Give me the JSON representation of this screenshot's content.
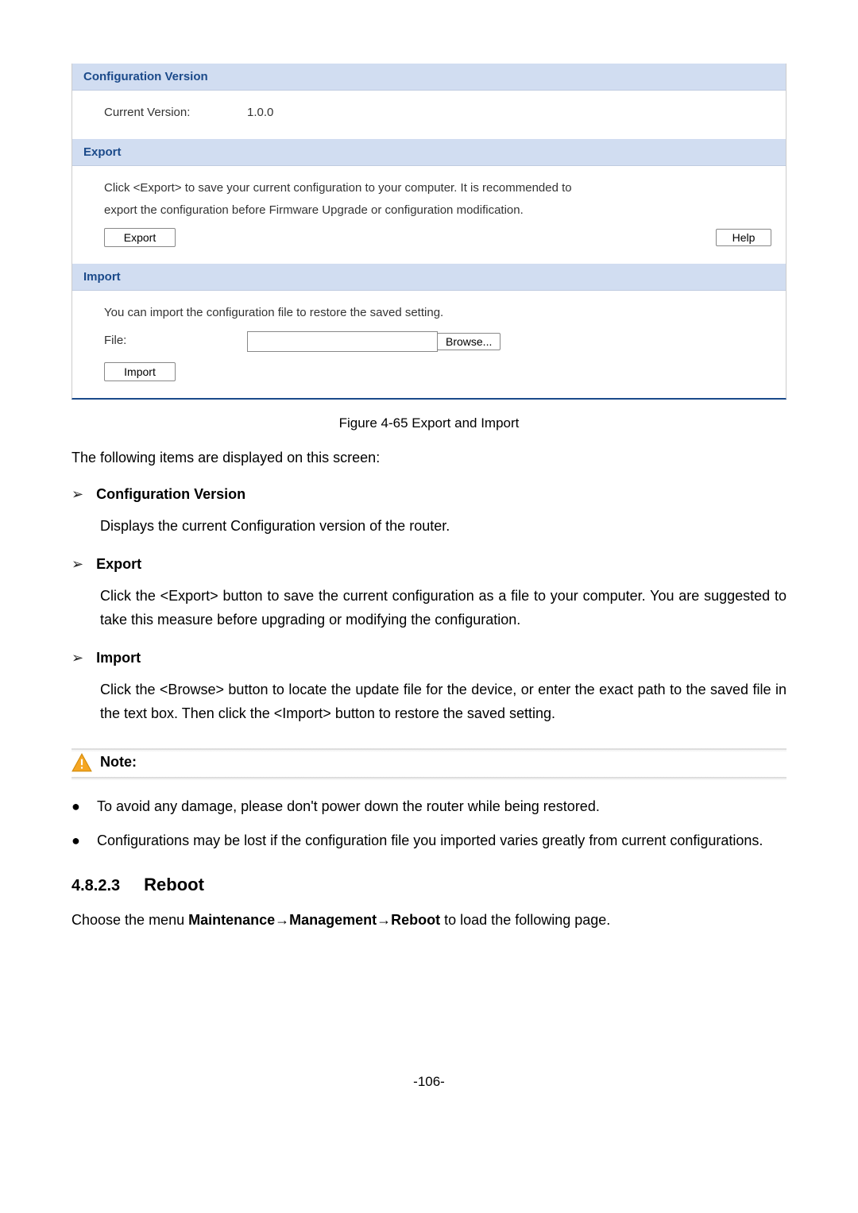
{
  "panel": {
    "configVersion": {
      "header": "Configuration Version",
      "label": "Current Version:",
      "value": "1.0.0"
    },
    "export": {
      "header": "Export",
      "text": "Click <Export> to save your current configuration to your computer. It is recommended to export the configuration before Firmware Upgrade or configuration modification.",
      "button": "Export",
      "help": "Help"
    },
    "import": {
      "header": "Import",
      "text": "You can import the configuration file to restore the saved setting.",
      "fileLabel": "File:",
      "browse": "Browse...",
      "button": "Import"
    }
  },
  "figureCaption": "Figure 4-65 Export and Import",
  "intro": "The following items are displayed on this screen:",
  "items": {
    "configVersion": {
      "title": "Configuration Version",
      "desc": "Displays the current Configuration version of the router."
    },
    "export": {
      "title": "Export",
      "desc": "Click the <Export> button to save the current configuration as a file to your computer. You are suggested to take this measure before upgrading or modifying the configuration."
    },
    "import": {
      "title": "Import",
      "desc": "Click the <Browse> button to locate the update file for the device, or enter the exact path to the saved file in the text box. Then click the <Import> button to restore the saved setting."
    }
  },
  "note": {
    "label": "Note:",
    "bullets": [
      "To avoid any damage, please don't power down the router while being restored.",
      "Configurations may be lost if the configuration file you imported varies greatly from current configurations."
    ]
  },
  "reboot": {
    "num": "4.8.2.3",
    "title": "Reboot",
    "textPrefix": "Choose the menu ",
    "textBold": "Maintenance→Management→Reboot",
    "textSuffix": " to load the following page."
  },
  "pageNum": "-106-"
}
